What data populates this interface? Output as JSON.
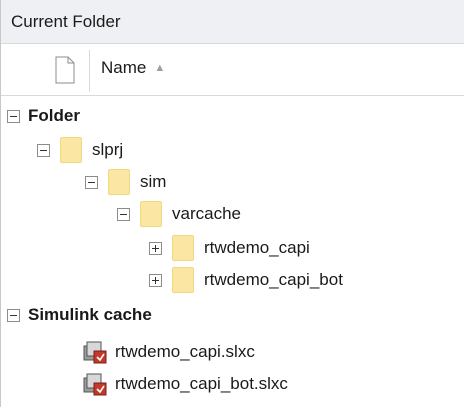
{
  "panel": {
    "title": "Current Folder"
  },
  "columns": {
    "name_label": "Name",
    "sort_indicator": "▲"
  },
  "groups": {
    "folder": {
      "label": "Folder",
      "items": {
        "slprj": "slprj",
        "sim": "sim",
        "varcache": "varcache",
        "rtwdemo_capi": "rtwdemo_capi",
        "rtwdemo_capi_bot": "rtwdemo_capi_bot"
      }
    },
    "simulink_cache": {
      "label": "Simulink cache",
      "files": [
        "rtwdemo_capi.slxc",
        "rtwdemo_capi_bot.slxc"
      ]
    }
  },
  "icons": {
    "folder": "folder-icon",
    "slxc": "simulink-cache-file-icon",
    "document": "document-icon"
  },
  "colors": {
    "folder_fill": "#fbe6a3",
    "header_bg": "#eef0f3"
  }
}
